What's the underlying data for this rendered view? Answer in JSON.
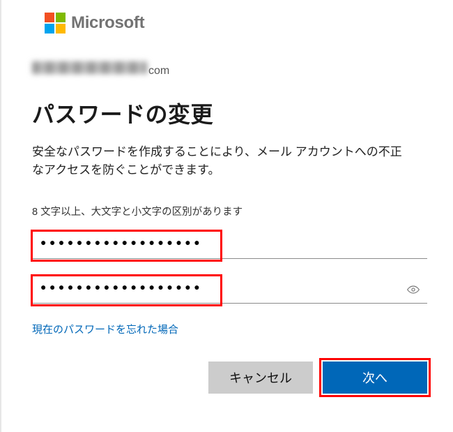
{
  "logo": {
    "brand_text": "Microsoft"
  },
  "account": {
    "email_suffix": "com"
  },
  "heading": "パスワードの変更",
  "description": "安全なパスワードを作成することにより、メール アカウントへの不正なアクセスを防ぐことができます。",
  "rule": "8 文字以上、大文字と小文字の区別があります",
  "password_mask": "●●●●●●●●●●●●●●●●●●",
  "password_mask_2": "●●●●●●●●●●●●●●●●●●",
  "forgot_link": "現在のパスワードを忘れた場合",
  "buttons": {
    "cancel": "キャンセル",
    "next": "次へ"
  },
  "colors": {
    "accent": "#0067b8",
    "highlight": "#ff0000"
  }
}
